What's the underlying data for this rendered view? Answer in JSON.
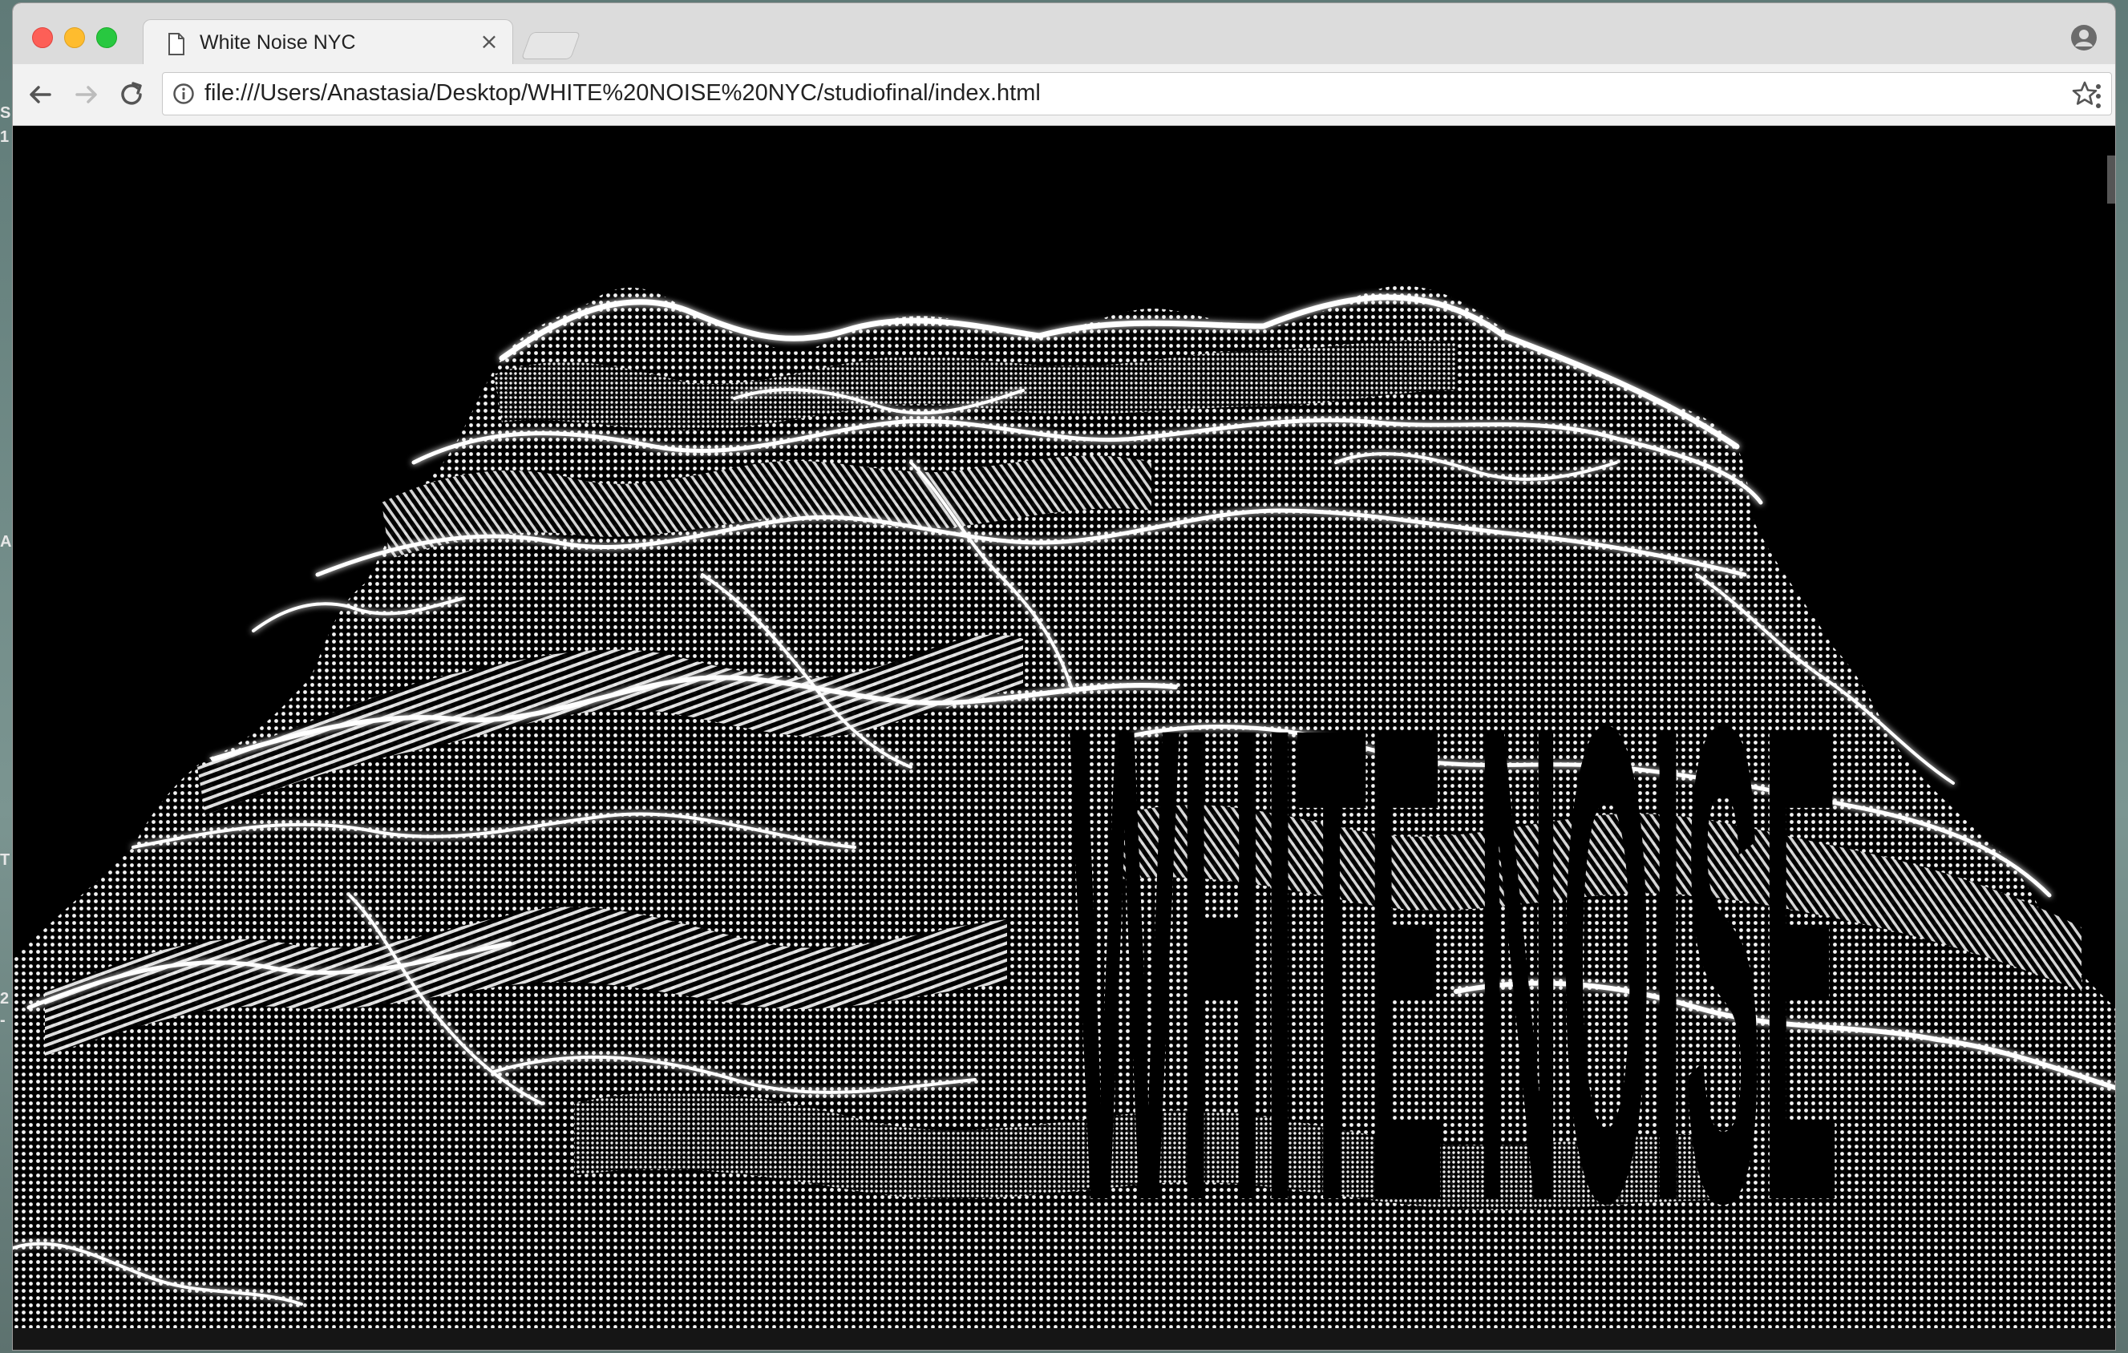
{
  "browser": {
    "tab_title": "White Noise NYC",
    "tab_close": "×",
    "url": "file:///Users/Anastasia/Desktop/WHITE%20NOISE%20NYC/studiofinal/index.html"
  },
  "page": {
    "hero_title": "WHITE NOISE",
    "background": "#000000",
    "foreground": "#ffffff"
  },
  "icons": {
    "back": "back-arrow-icon",
    "forward": "forward-arrow-icon",
    "reload": "reload-icon",
    "info": "info-icon",
    "bookmark": "star-icon",
    "menu": "kebab-menu-icon",
    "profile": "profile-icon",
    "page": "document-icon"
  }
}
